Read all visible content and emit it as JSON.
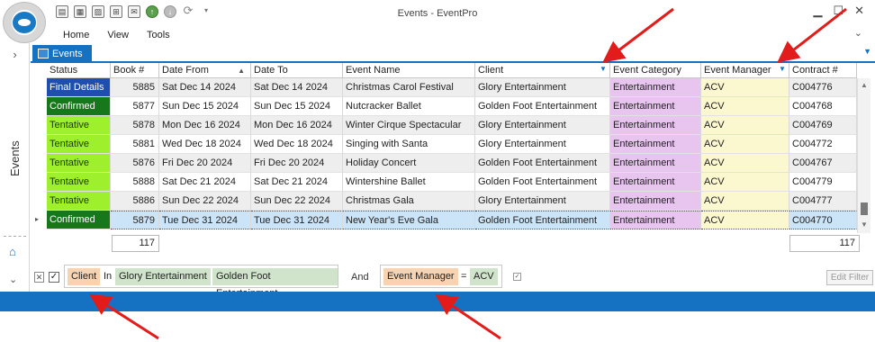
{
  "window": {
    "title": "Events - EventPro",
    "menu": [
      "Home",
      "View",
      "Tools"
    ]
  },
  "qat_icons": [
    "save-icon",
    "calendar-icon",
    "image-icon",
    "cart-icon",
    "email-icon",
    "up-arrow-icon",
    "down-arrow-icon",
    "refresh-icon",
    "dropdown-icon"
  ],
  "nav": {
    "label": "Events"
  },
  "tab": {
    "label": "Events"
  },
  "grid": {
    "columns": [
      "Status",
      "Book #",
      "Date From",
      "Date To",
      "Event Name",
      "Client",
      "Event Category",
      "Event Manager",
      "Contract #"
    ],
    "rows": [
      {
        "status": "Final Details",
        "book": "5885",
        "date_from": "Sat Dec 14 2024",
        "date_to": "Sat Dec 14 2024",
        "event_name": "Christmas Carol Festival",
        "client": "Glory Entertainment",
        "category": "Entertainment",
        "manager": "ACV",
        "contract": "C004776"
      },
      {
        "status": "Confirmed",
        "book": "5877",
        "date_from": "Sun Dec 15 2024",
        "date_to": "Sun Dec 15 2024",
        "event_name": "Nutcracker Ballet",
        "client": "Golden Foot Entertainment",
        "category": "Entertainment",
        "manager": "ACV",
        "contract": "C004768"
      },
      {
        "status": "Tentative",
        "book": "5878",
        "date_from": "Mon Dec 16 2024",
        "date_to": "Mon Dec 16 2024",
        "event_name": "Winter Cirque Spectacular",
        "client": "Glory Entertainment",
        "category": "Entertainment",
        "manager": "ACV",
        "contract": "C004769"
      },
      {
        "status": "Tentative",
        "book": "5881",
        "date_from": "Wed Dec 18 2024",
        "date_to": "Wed Dec 18 2024",
        "event_name": "Singing with Santa",
        "client": "Glory Entertainment",
        "category": "Entertainment",
        "manager": "ACV",
        "contract": "C004772"
      },
      {
        "status": "Tentative",
        "book": "5876",
        "date_from": "Fri Dec 20 2024",
        "date_to": "Fri Dec 20 2024",
        "event_name": "Holiday Concert",
        "client": "Golden Foot Entertainment",
        "category": "Entertainment",
        "manager": "ACV",
        "contract": "C004767"
      },
      {
        "status": "Tentative",
        "book": "5888",
        "date_from": "Sat Dec 21 2024",
        "date_to": "Sat Dec 21 2024",
        "event_name": "Wintershine Ballet",
        "client": "Golden Foot Entertainment",
        "category": "Entertainment",
        "manager": "ACV",
        "contract": "C004779"
      },
      {
        "status": "Tentative",
        "book": "5886",
        "date_from": "Sun Dec 22 2024",
        "date_to": "Sun Dec 22 2024",
        "event_name": "Christmas Gala",
        "client": "Glory Entertainment",
        "category": "Entertainment",
        "manager": "ACV",
        "contract": "C004777"
      },
      {
        "status": "Confirmed",
        "book": "5879",
        "date_from": "Tue Dec 31 2024",
        "date_to": "Tue Dec 31 2024",
        "event_name": "New Year's Eve Gala",
        "client": "Golden Foot Entertainment",
        "category": "Entertainment",
        "manager": "ACV",
        "contract": "C004770"
      }
    ],
    "totals": {
      "book": "117",
      "contract": "117"
    }
  },
  "status_colors": {
    "Final Details": "#1e4fb0",
    "Confirmed": "#17781b",
    "Tentative": "#9ef02c"
  },
  "column_colors": {
    "category": "#e7c5ef",
    "manager": "#fbf8cf",
    "selected_row": "#cce4f7",
    "alt_row": "#eeeeee",
    "accent": "#1572c3",
    "arrow": "#e21b1b"
  },
  "filter": {
    "field1": "Client",
    "op1": "In",
    "values1": [
      "Glory Entertainment",
      "Golden Foot Entertainment"
    ],
    "join": "And",
    "field2": "Event Manager",
    "op2": "=",
    "value2": "ACV",
    "edit_label": "Edit Filter"
  }
}
